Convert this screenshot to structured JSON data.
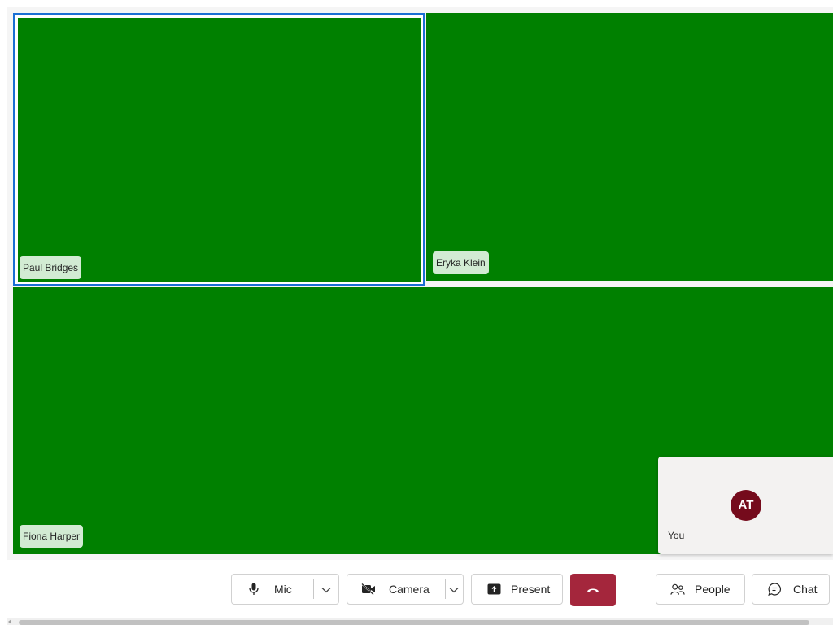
{
  "participants": [
    {
      "name": "Paul Bridges",
      "active": true
    },
    {
      "name": "Eryka Klein",
      "active": false
    },
    {
      "name": "Fiona Harper",
      "active": false
    }
  ],
  "self": {
    "initials": "AT",
    "label": "You",
    "avatar_color": "#750b1c"
  },
  "toolbar": {
    "mic_label": "Mic",
    "camera_label": "Camera",
    "present_label": "Present",
    "people_label": "People",
    "chat_label": "Chat"
  },
  "colors": {
    "video_background": "#008000",
    "active_speaker_border": "#1a6fd4",
    "hangup": "#a4263c"
  },
  "icons": {
    "mic": "microphone-icon",
    "camera": "camera-off-icon",
    "present": "share-screen-icon",
    "hangup": "phone-hangup-icon",
    "people": "people-icon",
    "chat": "chat-bubble-icon",
    "dropdown": "chevron-down-icon"
  }
}
